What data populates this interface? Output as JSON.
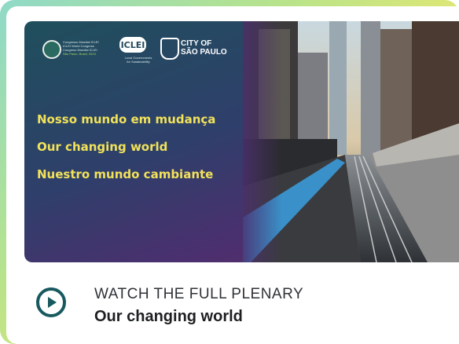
{
  "thumbnail": {
    "logos": {
      "congress_lines": [
        "Congresso Mundial ICLEI",
        "ICLEI World Congress",
        "Congreso Mundial ICLEI"
      ],
      "congress_sub": "São Paulo, Brasil, 2024",
      "iclei_badge": "ICLEI",
      "iclei_sub_lines": [
        "Local Governments",
        "for Sustainability"
      ],
      "city_line1": "CITY OF",
      "city_line2": "SÃO PAULO"
    },
    "headlines": [
      "Nosso mundo em mudança",
      "Our changing world",
      "Nuestro mundo cambiante"
    ]
  },
  "footer": {
    "watch_label": "WATCH THE FULL PLENARY",
    "title": "Our changing world",
    "play_icon": "play-circle-icon"
  },
  "colors": {
    "headline": "#f2e25a",
    "accent": "#17595f"
  }
}
